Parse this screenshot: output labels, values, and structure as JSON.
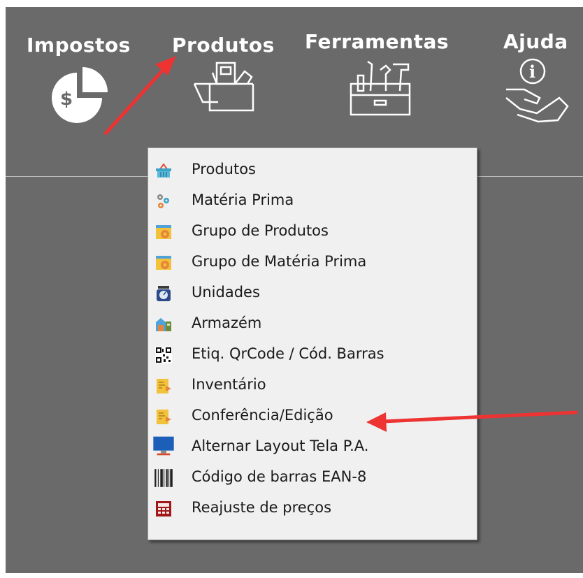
{
  "toolbar": {
    "items": [
      {
        "label": "Impostos",
        "icon": "pie-chart-dollar-icon"
      },
      {
        "label": "Produtos",
        "icon": "box-icon"
      },
      {
        "label": "Ferramentas",
        "icon": "toolbox-icon"
      },
      {
        "label": "Ajuda",
        "icon": "help-hand-icon"
      }
    ]
  },
  "menu": {
    "items": [
      {
        "label": "Produtos",
        "icon": "basket-icon"
      },
      {
        "label": "Matéria Prima",
        "icon": "gears-icon"
      },
      {
        "label": "Grupo de Produtos",
        "icon": "group-gear-icon"
      },
      {
        "label": "Grupo de Matéria Prima",
        "icon": "group-gear-icon"
      },
      {
        "label": "Unidades",
        "icon": "scale-icon"
      },
      {
        "label": "Armazém",
        "icon": "warehouse-icon"
      },
      {
        "label": "Etiq. QrCode / Cód. Barras",
        "icon": "qrcode-icon"
      },
      {
        "label": "Inventário",
        "icon": "document-icon"
      },
      {
        "label": "Conferência/Edição",
        "icon": "document-icon"
      },
      {
        "label": "Alternar Layout Tela P.A.",
        "icon": "monitor-icon"
      },
      {
        "label": "Código de barras EAN-8",
        "icon": "barcode-icon"
      },
      {
        "label": "Reajuste de preços",
        "icon": "calculator-icon"
      }
    ]
  },
  "colors": {
    "background": "#6a6a6a",
    "menu": "#f0f0f0",
    "annotation_arrow": "#ee3333"
  }
}
